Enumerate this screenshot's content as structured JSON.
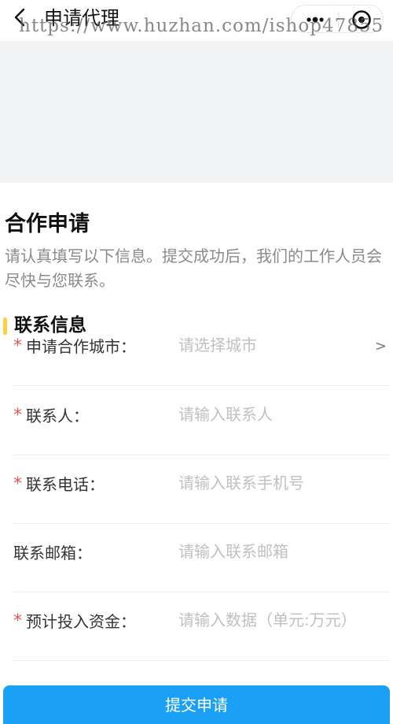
{
  "nav": {
    "title": "申请代理",
    "back_icon": "chevron-left-icon",
    "more_icon": "more-dots-icon",
    "close_icon": "target-icon"
  },
  "watermark": "https://www.huzhan.com/ishop47855",
  "form": {
    "title": "合作申请",
    "description": "请认真填写以下信息。提交成功后，我们的工作人员会尽快与您联系。",
    "section_title": "联系信息",
    "required_mark": "*",
    "fields": [
      {
        "label": "申请合作城市：",
        "placeholder": "请选择城市",
        "required": true,
        "chevron": ">"
      },
      {
        "label": "联系人：",
        "placeholder": "请输入联系人",
        "required": true
      },
      {
        "label": "联系电话：",
        "placeholder": "请输入联系手机号",
        "required": true
      },
      {
        "label": "联系邮箱：",
        "placeholder": "请输入联系邮箱",
        "required": false
      },
      {
        "label": "预计投入资金：",
        "placeholder": "请输入数据（单元:万元）",
        "required": true
      }
    ],
    "submit_label": "提交申请"
  },
  "colors": {
    "accent": "#1aa1f5",
    "required": "#e05a5a",
    "section_bar": "#ffcf3f",
    "banner": "#f2f3f5"
  }
}
